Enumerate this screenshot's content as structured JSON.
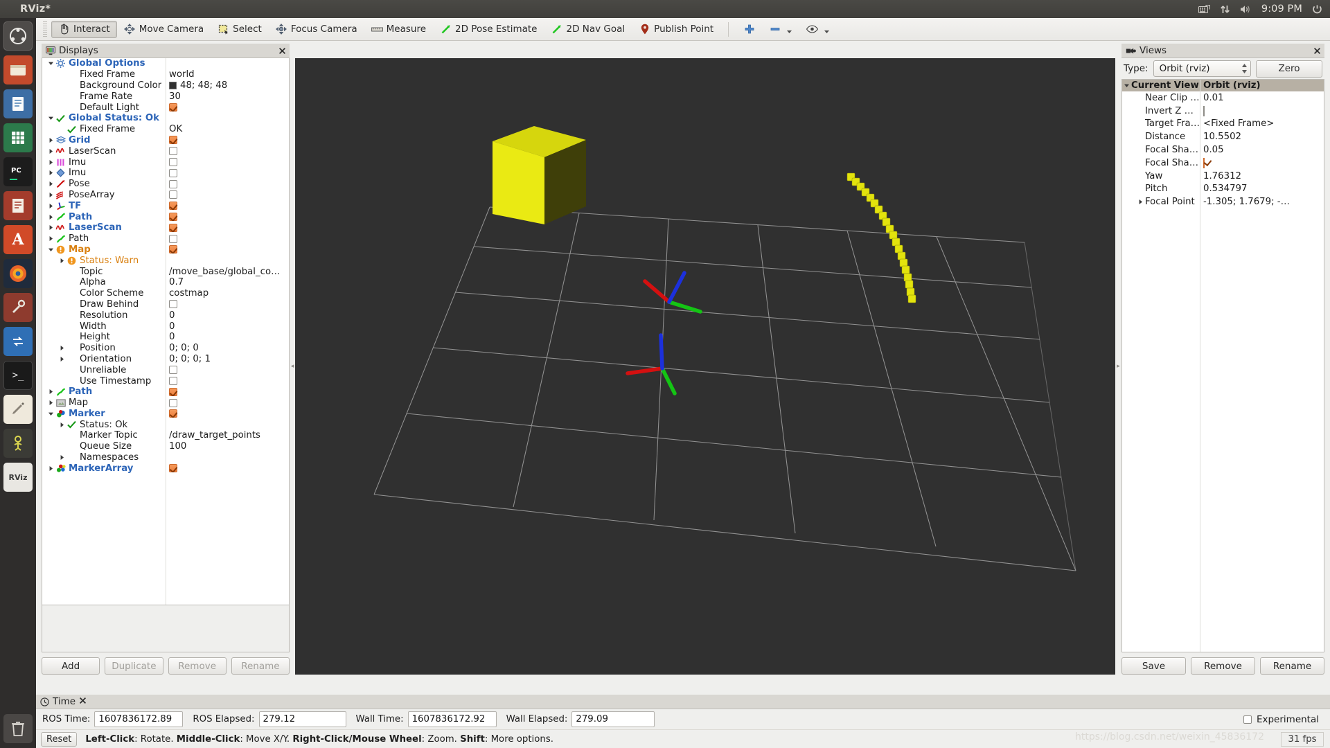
{
  "window": {
    "title": "RViz*"
  },
  "tray": {
    "clock": "9:09 PM",
    "icons": [
      "keyboard-icon",
      "network-icon",
      "volume-icon",
      "power-icon"
    ]
  },
  "launcher": {
    "items": [
      {
        "name": "ubuntu-dash-icon",
        "glyph": "●"
      },
      {
        "name": "files-icon",
        "glyph": "▤"
      },
      {
        "name": "text-editor-icon",
        "glyph": "≣"
      },
      {
        "name": "spreadsheet-icon",
        "glyph": "▦"
      },
      {
        "name": "pycharm-icon",
        "glyph": "PC"
      },
      {
        "name": "document-viewer-icon",
        "glyph": "▧"
      },
      {
        "name": "software-center-icon",
        "glyph": "A"
      },
      {
        "name": "firefox-icon",
        "glyph": "◉"
      },
      {
        "name": "tweak-tool-icon",
        "glyph": "⚒"
      },
      {
        "name": "system-settings-icon",
        "glyph": "⇄"
      },
      {
        "name": "terminal-icon",
        "glyph": ">_"
      },
      {
        "name": "notes-icon",
        "glyph": "✎"
      },
      {
        "name": "gazebo-icon",
        "glyph": "♟"
      },
      {
        "name": "rviz-icon",
        "glyph": "RViz"
      },
      {
        "name": "trash-icon",
        "glyph": "Ὕ1"
      }
    ]
  },
  "toolbar": {
    "tools": [
      {
        "label": "Interact",
        "icon": "hand-cursor-icon",
        "pressed": true
      },
      {
        "label": "Move Camera",
        "icon": "move-camera-icon",
        "pressed": false
      },
      {
        "label": "Select",
        "icon": "select-box-icon",
        "pressed": false
      },
      {
        "label": "Focus Camera",
        "icon": "focus-camera-icon",
        "pressed": false
      },
      {
        "label": "Measure",
        "icon": "ruler-icon",
        "pressed": false
      },
      {
        "label": "2D Pose Estimate",
        "icon": "green-arrow-icon",
        "pressed": false
      },
      {
        "label": "2D Nav Goal",
        "icon": "green-arrow-icon",
        "pressed": false
      },
      {
        "label": "Publish Point",
        "icon": "map-pin-icon",
        "pressed": false
      }
    ],
    "extra": [
      {
        "name": "add-tool-icon",
        "glyph": "plus"
      },
      {
        "name": "remove-tool-icon",
        "glyph": "minus"
      },
      {
        "name": "visibility-icon",
        "glyph": "eye"
      }
    ]
  },
  "displays": {
    "title": "Displays",
    "title_icon": "display-monitor-icon",
    "close_icon": "close-icon",
    "buttons": [
      {
        "label": "Add",
        "enabled": true
      },
      {
        "label": "Duplicate",
        "enabled": false
      },
      {
        "label": "Remove",
        "enabled": false
      },
      {
        "label": "Rename",
        "enabled": false
      }
    ],
    "rows": [
      {
        "indent": 0,
        "twisty": "down",
        "icon": "gear-icon",
        "label": "Global Options",
        "style": "on",
        "value": ""
      },
      {
        "indent": 1,
        "twisty": "",
        "icon": "",
        "label": "Fixed Frame",
        "style": "",
        "value": "world"
      },
      {
        "indent": 1,
        "twisty": "",
        "icon": "",
        "label": "Background Color",
        "style": "",
        "value": "48; 48; 48",
        "swatch": "#303030"
      },
      {
        "indent": 1,
        "twisty": "",
        "icon": "",
        "label": "Frame Rate",
        "style": "",
        "value": "30"
      },
      {
        "indent": 1,
        "twisty": "",
        "icon": "",
        "label": "Default Light",
        "style": "",
        "check": "on"
      },
      {
        "indent": 0,
        "twisty": "down",
        "icon": "check-icon",
        "label": "Global Status: Ok",
        "style": "on",
        "value": ""
      },
      {
        "indent": 1,
        "twisty": "",
        "icon": "check-icon",
        "label": "Fixed Frame",
        "style": "",
        "value": "OK"
      },
      {
        "indent": 0,
        "twisty": "right",
        "icon": "grid-icon",
        "label": "Grid",
        "style": "on",
        "check": "on"
      },
      {
        "indent": 0,
        "twisty": "right",
        "icon": "laserscan-icon",
        "label": "LaserScan",
        "style": "",
        "check": "off"
      },
      {
        "indent": 0,
        "twisty": "right",
        "icon": "imu-bars-icon",
        "label": "Imu",
        "style": "",
        "check": "off"
      },
      {
        "indent": 0,
        "twisty": "right",
        "icon": "imu-diamond-icon",
        "label": "Imu",
        "style": "",
        "check": "off"
      },
      {
        "indent": 0,
        "twisty": "right",
        "icon": "pose-icon",
        "label": "Pose",
        "style": "",
        "check": "off"
      },
      {
        "indent": 0,
        "twisty": "right",
        "icon": "posearray-icon",
        "label": "PoseArray",
        "style": "",
        "check": "off"
      },
      {
        "indent": 0,
        "twisty": "right",
        "icon": "tf-axes-icon",
        "label": "TF",
        "style": "on",
        "check": "on"
      },
      {
        "indent": 0,
        "twisty": "right",
        "icon": "path-icon",
        "label": "Path",
        "style": "on",
        "check": "on"
      },
      {
        "indent": 0,
        "twisty": "right",
        "icon": "laserscan-icon",
        "label": "LaserScan",
        "style": "on",
        "check": "on"
      },
      {
        "indent": 0,
        "twisty": "right",
        "icon": "path-icon",
        "label": "Path",
        "style": "",
        "check": "off"
      },
      {
        "indent": 0,
        "twisty": "down",
        "icon": "warn-icon",
        "label": "Map",
        "style": "warn",
        "check": "on"
      },
      {
        "indent": 1,
        "twisty": "right",
        "icon": "warn-icon",
        "label": "Status: Warn",
        "style": "warnsub",
        "value": ""
      },
      {
        "indent": 1,
        "twisty": "",
        "icon": "",
        "label": "Topic",
        "style": "",
        "value": "/move_base/global_co…"
      },
      {
        "indent": 1,
        "twisty": "",
        "icon": "",
        "label": "Alpha",
        "style": "",
        "value": "0.7"
      },
      {
        "indent": 1,
        "twisty": "",
        "icon": "",
        "label": "Color Scheme",
        "style": "",
        "value": "costmap"
      },
      {
        "indent": 1,
        "twisty": "",
        "icon": "",
        "label": "Draw Behind",
        "style": "",
        "check": "off"
      },
      {
        "indent": 1,
        "twisty": "",
        "icon": "",
        "label": "Resolution",
        "style": "",
        "value": "0"
      },
      {
        "indent": 1,
        "twisty": "",
        "icon": "",
        "label": "Width",
        "style": "",
        "value": "0"
      },
      {
        "indent": 1,
        "twisty": "",
        "icon": "",
        "label": "Height",
        "style": "",
        "value": "0"
      },
      {
        "indent": 1,
        "twisty": "right",
        "icon": "",
        "label": "Position",
        "style": "",
        "value": "0; 0; 0"
      },
      {
        "indent": 1,
        "twisty": "right",
        "icon": "",
        "label": "Orientation",
        "style": "",
        "value": "0; 0; 0; 1"
      },
      {
        "indent": 1,
        "twisty": "",
        "icon": "",
        "label": "Unreliable",
        "style": "",
        "check": "off"
      },
      {
        "indent": 1,
        "twisty": "",
        "icon": "",
        "label": "Use Timestamp",
        "style": "",
        "check": "off"
      },
      {
        "indent": 0,
        "twisty": "right",
        "icon": "path-icon",
        "label": "Path",
        "style": "on",
        "check": "on"
      },
      {
        "indent": 0,
        "twisty": "right",
        "icon": "map-icon",
        "label": "Map",
        "style": "",
        "check": "off"
      },
      {
        "indent": 0,
        "twisty": "down",
        "icon": "marker-icon",
        "label": "Marker",
        "style": "on",
        "check": "on"
      },
      {
        "indent": 1,
        "twisty": "right",
        "icon": "check-icon",
        "label": "Status: Ok",
        "style": "",
        "value": ""
      },
      {
        "indent": 1,
        "twisty": "",
        "icon": "",
        "label": "Marker Topic",
        "style": "",
        "value": "/draw_target_points"
      },
      {
        "indent": 1,
        "twisty": "",
        "icon": "",
        "label": "Queue Size",
        "style": "",
        "value": "100"
      },
      {
        "indent": 1,
        "twisty": "right",
        "icon": "",
        "label": "Namespaces",
        "style": "",
        "value": ""
      },
      {
        "indent": 0,
        "twisty": "right",
        "icon": "markerarray-icon",
        "label": "MarkerArray",
        "style": "on",
        "check": "on"
      }
    ]
  },
  "views": {
    "title": "Views",
    "title_icon": "camera-icon",
    "close_icon": "close-icon",
    "type_label": "Type:",
    "type_value": "Orbit (rviz)",
    "zero_label": "Zero",
    "header": {
      "col1": "Current View",
      "col2": "Orbit (rviz)"
    },
    "rows": [
      {
        "label": "Near Clip …",
        "value": "0.01",
        "indent": 1,
        "twisty": ""
      },
      {
        "label": "Invert Z Axis",
        "value": "",
        "indent": 1,
        "twisty": "",
        "check": "off"
      },
      {
        "label": "Target Fra…",
        "value": "<Fixed Frame>",
        "indent": 1,
        "twisty": ""
      },
      {
        "label": "Distance",
        "value": "10.5502",
        "indent": 1,
        "twisty": ""
      },
      {
        "label": "Focal Shap…",
        "value": "0.05",
        "indent": 1,
        "twisty": ""
      },
      {
        "label": "Focal Shap…",
        "value": "",
        "indent": 1,
        "twisty": "",
        "check": "on"
      },
      {
        "label": "Yaw",
        "value": "1.76312",
        "indent": 1,
        "twisty": ""
      },
      {
        "label": "Pitch",
        "value": "0.534797",
        "indent": 1,
        "twisty": ""
      },
      {
        "label": "Focal Point",
        "value": "-1.305; 1.7679; -…",
        "indent": 1,
        "twisty": "right"
      }
    ],
    "buttons": [
      {
        "label": "Save"
      },
      {
        "label": "Remove"
      },
      {
        "label": "Rename"
      }
    ]
  },
  "time": {
    "title": "Time",
    "title_icon": "clock-icon",
    "close_icon": "close-icon",
    "ros_time_label": "ROS Time:",
    "ros_time_value": "1607836172.89",
    "ros_elapsed_label": "ROS Elapsed:",
    "ros_elapsed_value": "279.12",
    "wall_time_label": "Wall Time:",
    "wall_time_value": "1607836172.92",
    "wall_elapsed_label": "Wall Elapsed:",
    "wall_elapsed_value": "279.09",
    "experimental_label": "Experimental",
    "experimental_checked": false
  },
  "statusbar": {
    "reset_label": "Reset",
    "hint_parts": [
      {
        "text": "Left-Click",
        "bold": true
      },
      {
        "text": ": Rotate. ",
        "bold": false
      },
      {
        "text": "Middle-Click",
        "bold": true
      },
      {
        "text": ": Move X/Y. ",
        "bold": false
      },
      {
        "text": "Right-Click/Mouse Wheel",
        "bold": true
      },
      {
        "text": ": Zoom. ",
        "bold": false
      },
      {
        "text": "Shift",
        "bold": true
      },
      {
        "text": ": More options.",
        "bold": false
      }
    ],
    "fps": "31 fps",
    "watermark": "https://blog.csdn.net/weixin_45836172"
  },
  "scene": {
    "background_color": "#303030",
    "grid_color": "#9a9a9a",
    "cube_color": "#e8e80f",
    "marker_trail_color": "#e3e30d",
    "axes": [
      {
        "x_color": "#d41010",
        "y_color": "#14c414",
        "z_color": "#1c30dc"
      },
      {
        "x_color": "#d41010",
        "y_color": "#14c414",
        "z_color": "#1c30dc"
      }
    ]
  }
}
